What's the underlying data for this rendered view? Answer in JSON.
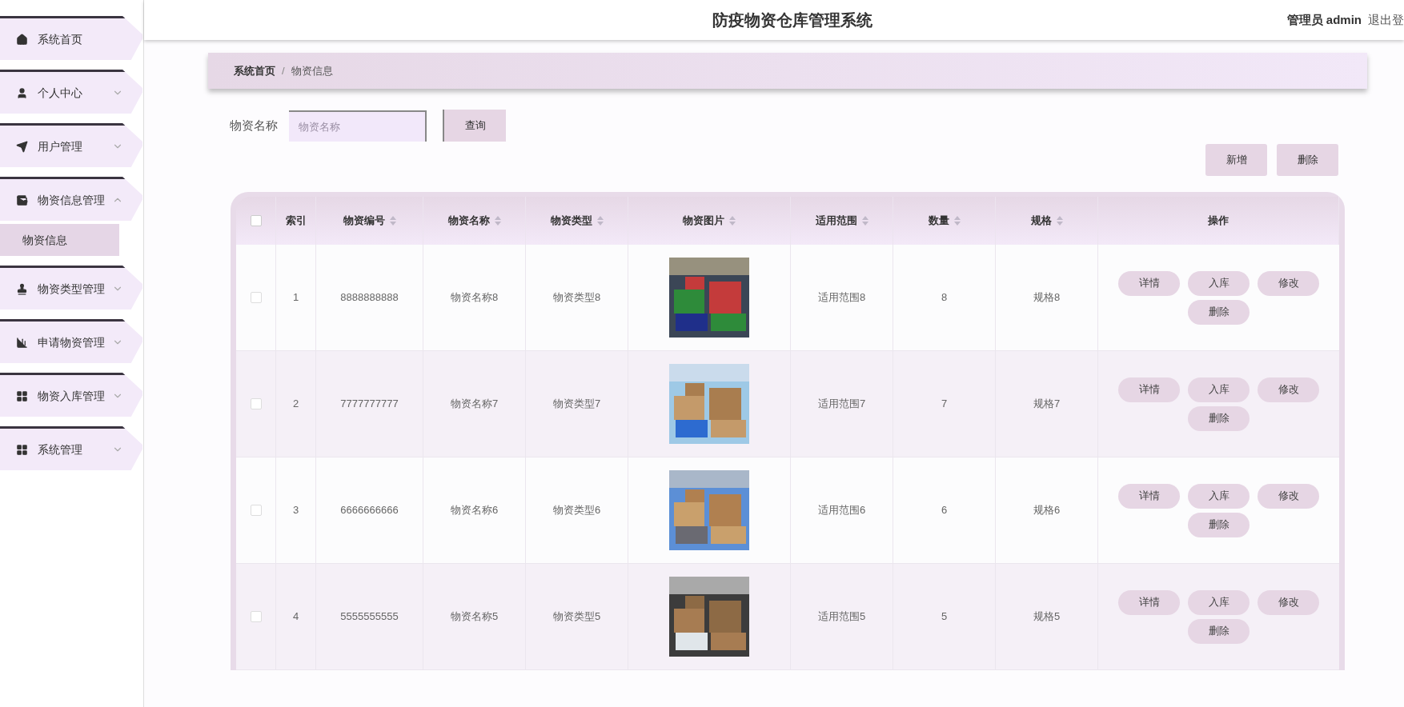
{
  "header": {
    "title": "防疫物资仓库管理系统",
    "user": "管理员 admin",
    "logout": "退出登"
  },
  "sidebar": {
    "items": [
      {
        "label": "系统首页",
        "has_arrow": false
      },
      {
        "label": "个人中心",
        "has_arrow": true,
        "expanded": false
      },
      {
        "label": "用户管理",
        "has_arrow": true,
        "expanded": false
      },
      {
        "label": "物资信息管理",
        "has_arrow": true,
        "expanded": true,
        "children": [
          {
            "label": "物资信息",
            "selected": true
          }
        ]
      },
      {
        "label": "物资类型管理",
        "has_arrow": true,
        "expanded": false
      },
      {
        "label": "申请物资管理",
        "has_arrow": true,
        "expanded": false
      },
      {
        "label": "物资入库管理",
        "has_arrow": true,
        "expanded": false
      },
      {
        "label": "系统管理",
        "has_arrow": true,
        "expanded": false
      }
    ]
  },
  "breadcrumb": {
    "items": [
      "系统首页",
      "物资信息"
    ],
    "separator": "/"
  },
  "search": {
    "label": "物资名称",
    "placeholder": "物资名称",
    "button": "查询"
  },
  "actions": [
    "新增",
    "删除"
  ],
  "table": {
    "select_all_checked": false,
    "columns": [
      {
        "label": "索引",
        "sortable": false
      },
      {
        "label": "物资编号",
        "sortable": true
      },
      {
        "label": "物资名称",
        "sortable": true
      },
      {
        "label": "物资类型",
        "sortable": true
      },
      {
        "label": "物资图片",
        "sortable": true
      },
      {
        "label": "适用范围",
        "sortable": true
      },
      {
        "label": "数量",
        "sortable": true
      },
      {
        "label": "规格",
        "sortable": true
      },
      {
        "label": "操作",
        "sortable": false
      }
    ],
    "rows": [
      {
        "checked": false,
        "cells": [
          {
            "kind": "text",
            "text": "1"
          },
          {
            "kind": "text",
            "text": "8888888888"
          },
          {
            "kind": "text",
            "text": "物资名称8"
          },
          {
            "kind": "text",
            "text": "物资类型8"
          },
          {
            "kind": "picture"
          },
          {
            "kind": "text",
            "text": "适用范围8"
          },
          {
            "kind": "text",
            "text": "8"
          },
          {
            "kind": "text",
            "text": "规格8"
          }
        ],
        "buttons": [
          "详情",
          "入库",
          "修改",
          "删除"
        ]
      },
      {
        "checked": false,
        "cells": [
          {
            "kind": "text",
            "text": "2"
          },
          {
            "kind": "text",
            "text": "7777777777"
          },
          {
            "kind": "text",
            "text": "物资名称7"
          },
          {
            "kind": "text",
            "text": "物资类型7"
          },
          {
            "kind": "picture"
          },
          {
            "kind": "text",
            "text": "适用范围7"
          },
          {
            "kind": "text",
            "text": "7"
          },
          {
            "kind": "text",
            "text": "规格7"
          }
        ],
        "buttons": [
          "详情",
          "入库",
          "修改",
          "删除"
        ]
      },
      {
        "checked": false,
        "cells": [
          {
            "kind": "text",
            "text": "3"
          },
          {
            "kind": "text",
            "text": "6666666666"
          },
          {
            "kind": "text",
            "text": "物资名称6"
          },
          {
            "kind": "text",
            "text": "物资类型6"
          },
          {
            "kind": "picture"
          },
          {
            "kind": "text",
            "text": "适用范围6"
          },
          {
            "kind": "text",
            "text": "6"
          },
          {
            "kind": "text",
            "text": "规格6"
          }
        ],
        "buttons": [
          "详情",
          "入库",
          "修改",
          "删除"
        ]
      },
      {
        "checked": false,
        "cells": [
          {
            "kind": "text",
            "text": "4"
          },
          {
            "kind": "text",
            "text": "5555555555"
          },
          {
            "kind": "text",
            "text": "物资名称5"
          },
          {
            "kind": "text",
            "text": "物资类型5"
          },
          {
            "kind": "picture"
          },
          {
            "kind": "text",
            "text": "适用范围5"
          },
          {
            "kind": "text",
            "text": "5"
          },
          {
            "kind": "text",
            "text": "规格5"
          }
        ],
        "buttons": [
          "详情",
          "入库",
          "修改",
          "删除"
        ]
      }
    ]
  }
}
